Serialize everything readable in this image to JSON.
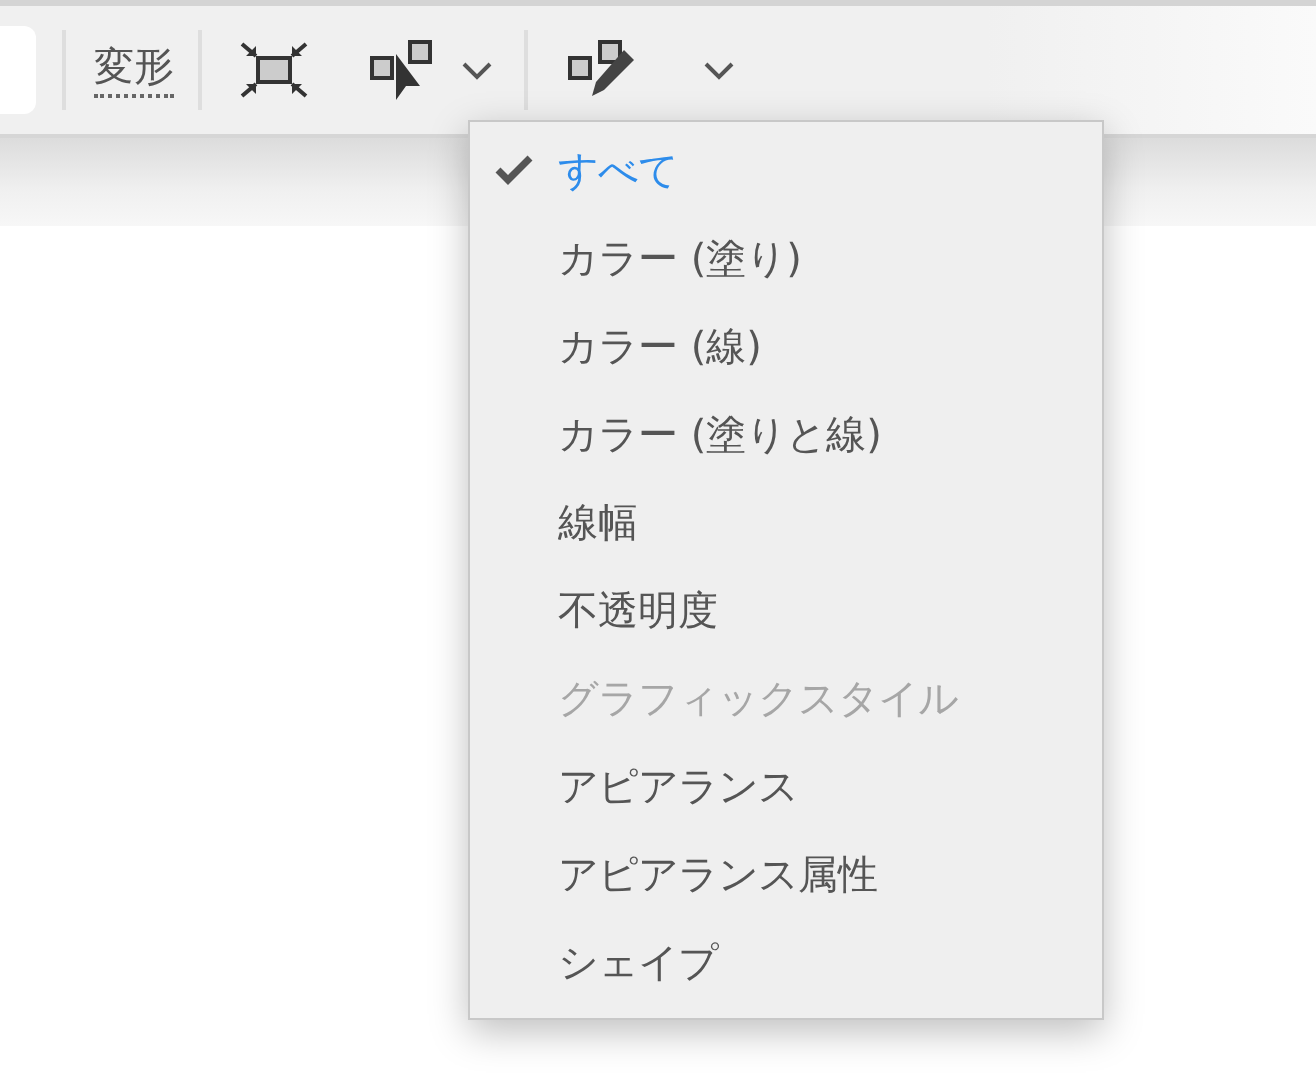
{
  "toolbar": {
    "transform_label": "変形"
  },
  "menu": {
    "items": [
      {
        "label": "すべて",
        "selected": true,
        "disabled": false
      },
      {
        "label": "カラー (塗り)",
        "selected": false,
        "disabled": false
      },
      {
        "label": "カラー (線)",
        "selected": false,
        "disabled": false
      },
      {
        "label": "カラー (塗りと線)",
        "selected": false,
        "disabled": false
      },
      {
        "label": "線幅",
        "selected": false,
        "disabled": false
      },
      {
        "label": "不透明度",
        "selected": false,
        "disabled": false
      },
      {
        "label": "グラフィックスタイル",
        "selected": false,
        "disabled": true
      },
      {
        "label": "アピアランス",
        "selected": false,
        "disabled": false
      },
      {
        "label": "アピアランス属性",
        "selected": false,
        "disabled": false
      },
      {
        "label": "シェイプ",
        "selected": false,
        "disabled": false
      }
    ]
  }
}
